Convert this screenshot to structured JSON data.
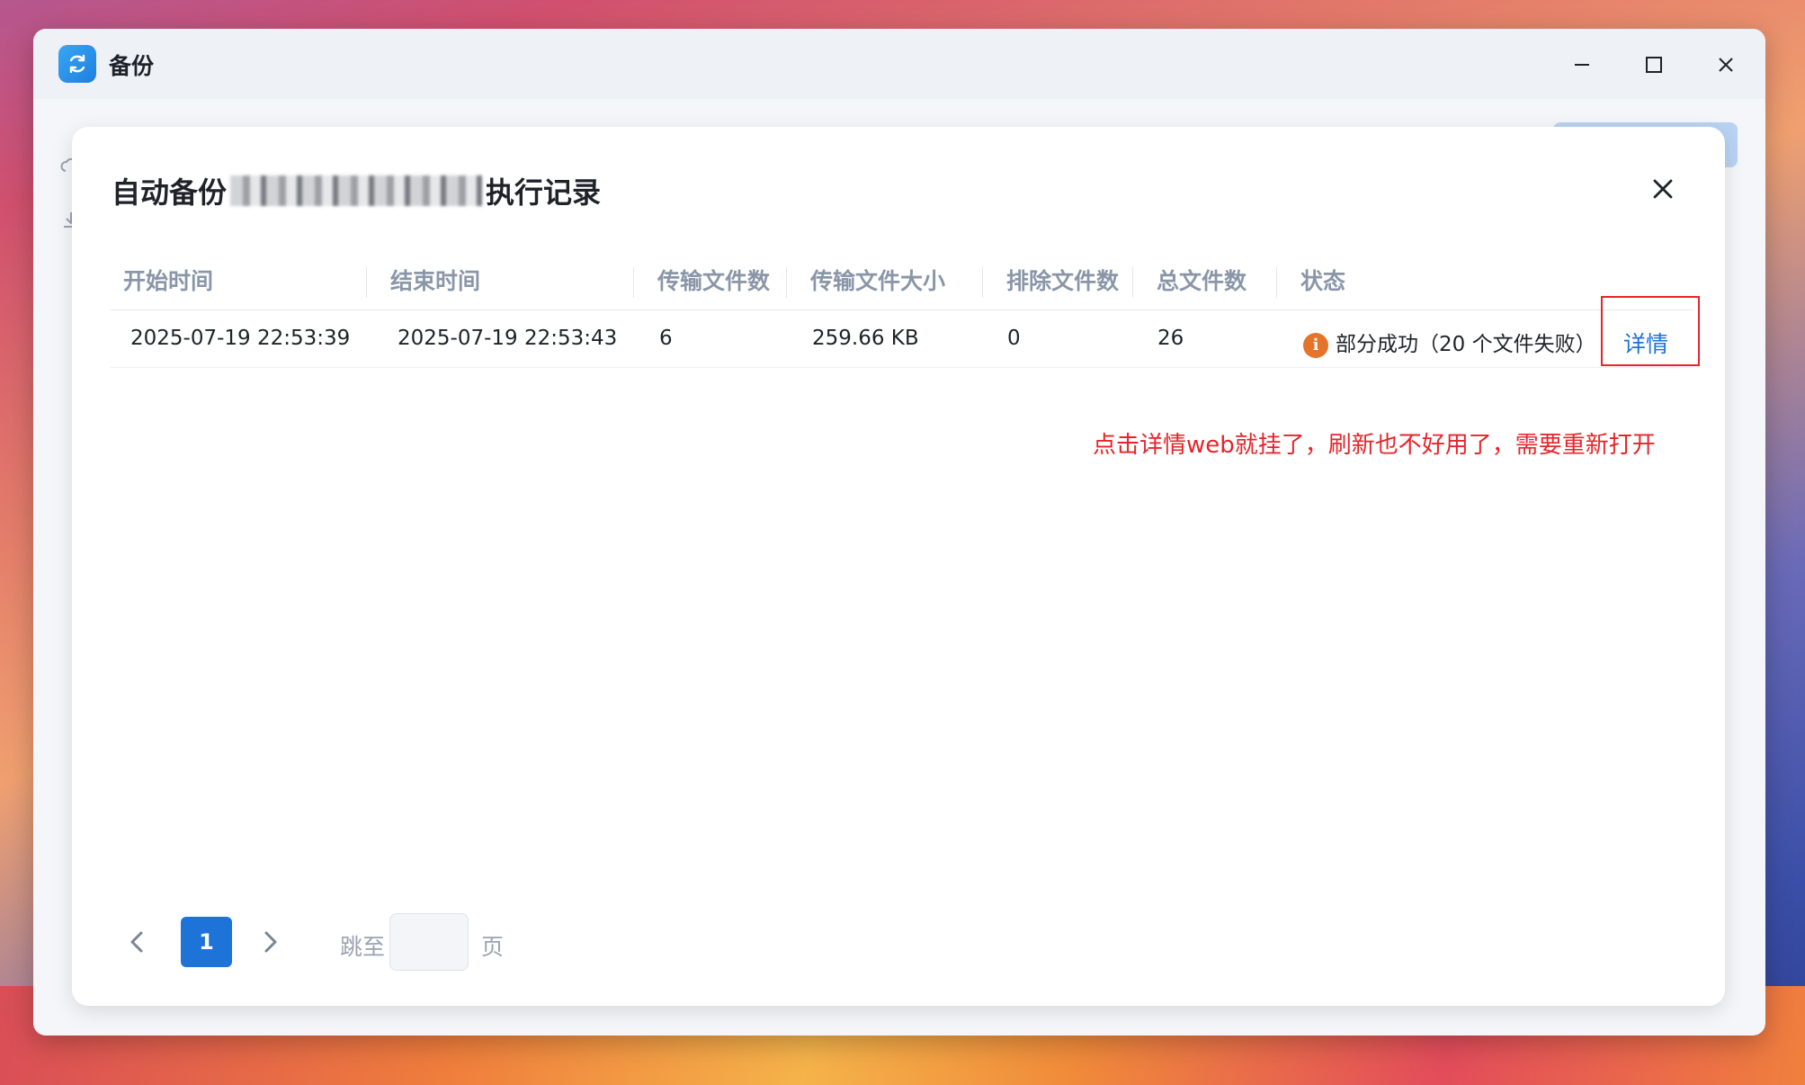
{
  "window": {
    "title": "备份"
  },
  "dialog": {
    "title_prefix": "自动备份",
    "title_suffix": "执行记录"
  },
  "table": {
    "headers": [
      "开始时间",
      "结束时间",
      "传输文件数",
      "传输文件大小",
      "排除文件数",
      "总文件数",
      "状态"
    ],
    "rows": [
      {
        "start_time": "2025-07-19 22:53:39",
        "end_time": "2025-07-19 22:53:43",
        "transferred_count": "6",
        "transferred_size": "259.66 KB",
        "excluded_count": "0",
        "total_count": "26",
        "status": "部分成功（20 个文件失败）",
        "action": "详情"
      }
    ]
  },
  "annotation": "点击详情web就挂了，刷新也不好用了，需要重新打开",
  "pagination": {
    "current_page": "1",
    "jump_label": "跳至",
    "page_suffix": "页",
    "jump_value": ""
  },
  "colors": {
    "accent": "#1d73d8",
    "warning": "#e5732a",
    "annotation": "#e5252b"
  },
  "icons": {
    "app": "backup-sync-icon",
    "minimize": "minimize-icon",
    "maximize": "maximize-icon",
    "close": "close-icon",
    "status": "info-warning-icon",
    "prev": "chevron-left-icon",
    "next": "chevron-right-icon"
  }
}
